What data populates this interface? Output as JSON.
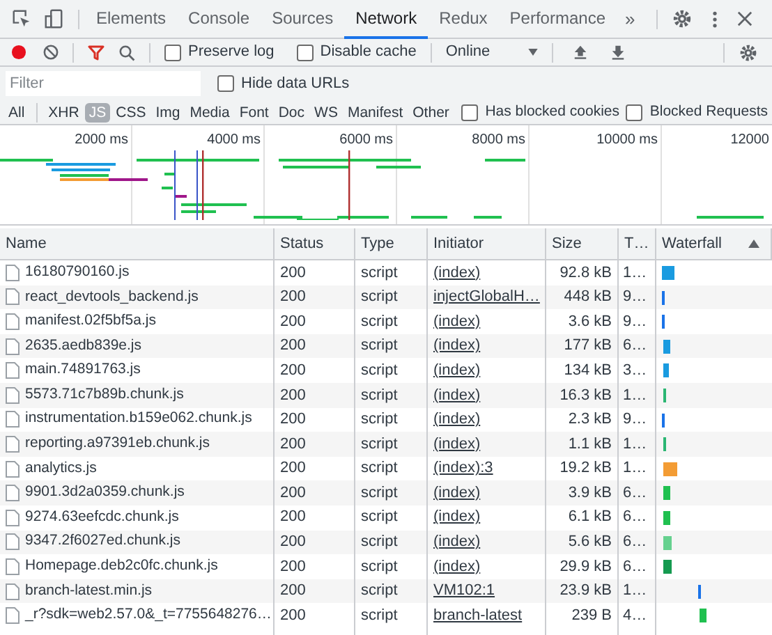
{
  "tabs": [
    {
      "label": "Elements",
      "selected": false
    },
    {
      "label": "Console",
      "selected": false
    },
    {
      "label": "Sources",
      "selected": false
    },
    {
      "label": "Network",
      "selected": true
    },
    {
      "label": "Redux",
      "selected": false
    },
    {
      "label": "Performance",
      "selected": false
    }
  ],
  "more_tabs": "»",
  "toolbar": {
    "recording": true,
    "filter_active": true,
    "preserve_log": {
      "label": "Preserve log",
      "checked": false
    },
    "disable_cache": {
      "label": "Disable cache",
      "checked": false
    },
    "throttling": "Online"
  },
  "filter": {
    "placeholder": "Filter",
    "hide_data_urls": {
      "label": "Hide data URLs",
      "checked": false
    }
  },
  "types": [
    {
      "label": "All",
      "selected": false
    },
    {
      "label": "XHR",
      "selected": false
    },
    {
      "label": "JS",
      "selected": true
    },
    {
      "label": "CSS",
      "selected": false
    },
    {
      "label": "Img",
      "selected": false
    },
    {
      "label": "Media",
      "selected": false
    },
    {
      "label": "Font",
      "selected": false
    },
    {
      "label": "Doc",
      "selected": false
    },
    {
      "label": "WS",
      "selected": false
    },
    {
      "label": "Manifest",
      "selected": false
    },
    {
      "label": "Other",
      "selected": false
    }
  ],
  "blocked_cookies": {
    "label": "Has blocked cookies",
    "checked": false
  },
  "blocked_requests": {
    "label": "Blocked Requests",
    "checked": false
  },
  "overview": {
    "ticks": [
      "2000 ms",
      "4000 ms",
      "6000 ms",
      "8000 ms",
      "10000 ms",
      "12000"
    ]
  },
  "table": {
    "columns": [
      "Name",
      "Status",
      "Type",
      "Initiator",
      "Size",
      "T…",
      "Waterfall"
    ],
    "sort_ascending": true,
    "rows": [
      {
        "name": "16180790160.js",
        "status": "200",
        "type": "script",
        "initiator": "(index)",
        "size": "92.8 kB",
        "time": "1…"
      },
      {
        "name": "react_devtools_backend.js",
        "status": "200",
        "type": "script",
        "initiator": "injectGlobalH…",
        "size": "448 kB",
        "time": "9…"
      },
      {
        "name": "manifest.02f5bf5a.js",
        "status": "200",
        "type": "script",
        "initiator": "(index)",
        "size": "3.6 kB",
        "time": "9…"
      },
      {
        "name": "2635.aedb839e.js",
        "status": "200",
        "type": "script",
        "initiator": "(index)",
        "size": "177 kB",
        "time": "6…"
      },
      {
        "name": "main.74891763.js",
        "status": "200",
        "type": "script",
        "initiator": "(index)",
        "size": "134 kB",
        "time": "3…"
      },
      {
        "name": "5573.71c7b89b.chunk.js",
        "status": "200",
        "type": "script",
        "initiator": "(index)",
        "size": "16.3 kB",
        "time": "1…"
      },
      {
        "name": "instrumentation.b159e062.chunk.js",
        "status": "200",
        "type": "script",
        "initiator": "(index)",
        "size": "2.3 kB",
        "time": "9…"
      },
      {
        "name": "reporting.a97391eb.chunk.js",
        "status": "200",
        "type": "script",
        "initiator": "(index)",
        "size": "1.1 kB",
        "time": "1…"
      },
      {
        "name": "analytics.js",
        "status": "200",
        "type": "script",
        "initiator": "(index):3",
        "size": "19.2 kB",
        "time": "1…"
      },
      {
        "name": "9901.3d2a0359.chunk.js",
        "status": "200",
        "type": "script",
        "initiator": "(index)",
        "size": "3.9 kB",
        "time": "6…"
      },
      {
        "name": "9274.63eefcdc.chunk.js",
        "status": "200",
        "type": "script",
        "initiator": "(index)",
        "size": "6.1 kB",
        "time": "6…"
      },
      {
        "name": "9347.2f6027ed.chunk.js",
        "status": "200",
        "type": "script",
        "initiator": "(index)",
        "size": "5.6 kB",
        "time": "6…"
      },
      {
        "name": "Homepage.deb2c0fc.chunk.js",
        "status": "200",
        "type": "script",
        "initiator": "(index)",
        "size": "29.9 kB",
        "time": "6…"
      },
      {
        "name": "branch-latest.min.js",
        "status": "200",
        "type": "script",
        "initiator": "VM102:1",
        "size": "23.9 kB",
        "time": "1…"
      },
      {
        "name": "_r?sdk=web2.57.0&_t=7755648276…",
        "status": "200",
        "type": "script",
        "initiator": "branch-latest",
        "size": "239 B",
        "time": "4…"
      }
    ]
  }
}
